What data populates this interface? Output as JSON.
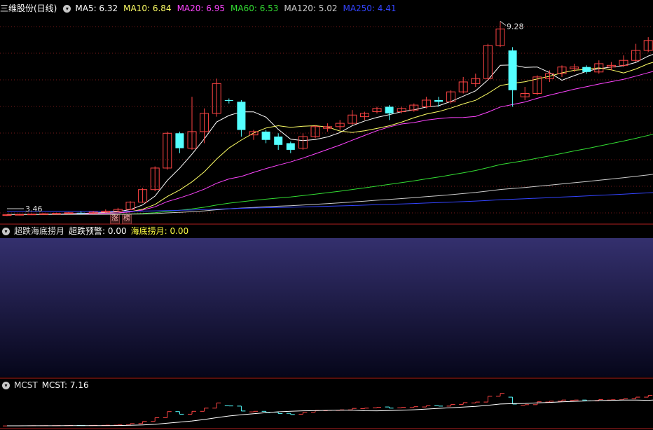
{
  "main_panel": {
    "title": "三维股份(日线)",
    "ma": [
      {
        "label": "MA5: 6.32",
        "color": "#ffffff"
      },
      {
        "label": "MA10: 6.84",
        "color": "#ffff66"
      },
      {
        "label": "MA20: 6.95",
        "color": "#ff44ff"
      },
      {
        "label": "MA60: 6.53",
        "color": "#33dd33"
      },
      {
        "label": "MA120: 5.02",
        "color": "#cccccc"
      },
      {
        "label": "MA250: 4.41",
        "color": "#3344ff"
      }
    ],
    "high_label": "9.28",
    "low_label": "3.46",
    "tags": [
      "涨",
      "榜"
    ]
  },
  "indicator_panel": {
    "name": "超跌海底捞月",
    "v1": "超跌预警: 0.00",
    "v2": "海底捞月: 0.00",
    "v2_color": "#ffff44"
  },
  "mcst_panel": {
    "name": "MCST",
    "value": "MCST: 7.16"
  },
  "chart_data": {
    "type": "candlestick",
    "price_range": [
      3.2,
      9.5
    ],
    "up_color": "#ff4444",
    "down_color": "#54ffff",
    "candles": [
      [
        3.42,
        3.46,
        3.4,
        3.44
      ],
      [
        3.44,
        3.47,
        3.42,
        3.45
      ],
      [
        3.45,
        3.48,
        3.43,
        3.46
      ],
      [
        3.46,
        3.49,
        3.44,
        3.47
      ],
      [
        3.47,
        3.5,
        3.45,
        3.48
      ],
      [
        3.48,
        3.52,
        3.46,
        3.5
      ],
      [
        3.5,
        3.54,
        3.48,
        3.49
      ],
      [
        3.49,
        3.55,
        3.47,
        3.52
      ],
      [
        3.52,
        3.6,
        3.5,
        3.55
      ],
      [
        3.55,
        3.65,
        3.52,
        3.6
      ],
      [
        3.6,
        3.85,
        3.58,
        3.82
      ],
      [
        3.82,
        4.25,
        3.8,
        4.2
      ],
      [
        4.2,
        4.9,
        4.15,
        4.85
      ],
      [
        4.85,
        5.95,
        4.8,
        5.9
      ],
      [
        5.9,
        5.95,
        5.3,
        5.45
      ],
      [
        5.45,
        7.0,
        5.4,
        5.95
      ],
      [
        5.95,
        6.65,
        5.6,
        6.5
      ],
      [
        6.5,
        7.55,
        6.4,
        7.4
      ],
      [
        6.9,
        6.95,
        6.8,
        6.88
      ],
      [
        6.85,
        6.9,
        5.8,
        6.0
      ],
      [
        5.85,
        6.0,
        5.7,
        5.95
      ],
      [
        5.95,
        6.0,
        5.6,
        5.7
      ],
      [
        5.8,
        5.9,
        5.4,
        5.55
      ],
      [
        5.6,
        5.65,
        5.3,
        5.4
      ],
      [
        5.45,
        5.9,
        5.4,
        5.8
      ],
      [
        5.8,
        6.15,
        5.75,
        6.1
      ],
      [
        6.05,
        6.2,
        5.95,
        6.1
      ],
      [
        6.1,
        6.3,
        6.0,
        6.2
      ],
      [
        6.2,
        6.6,
        6.15,
        6.45
      ],
      [
        6.4,
        6.55,
        6.3,
        6.5
      ],
      [
        6.55,
        6.7,
        6.5,
        6.65
      ],
      [
        6.7,
        6.75,
        6.3,
        6.5
      ],
      [
        6.55,
        6.7,
        6.5,
        6.65
      ],
      [
        6.6,
        6.8,
        6.55,
        6.75
      ],
      [
        6.7,
        7.0,
        6.65,
        6.9
      ],
      [
        6.9,
        7.0,
        6.7,
        6.85
      ],
      [
        6.85,
        7.2,
        6.8,
        7.15
      ],
      [
        7.15,
        7.6,
        7.1,
        7.45
      ],
      [
        7.4,
        7.7,
        7.3,
        7.55
      ],
      [
        7.55,
        8.6,
        7.5,
        8.55
      ],
      [
        8.55,
        9.28,
        8.5,
        9.05
      ],
      [
        8.4,
        8.5,
        6.7,
        7.2
      ],
      [
        7.0,
        7.3,
        6.9,
        7.1
      ],
      [
        7.1,
        7.65,
        7.05,
        7.6
      ],
      [
        7.55,
        7.8,
        7.45,
        7.7
      ],
      [
        7.7,
        7.95,
        7.6,
        7.9
      ],
      [
        7.85,
        8.0,
        7.75,
        7.9
      ],
      [
        7.9,
        7.95,
        7.7,
        7.75
      ],
      [
        7.75,
        8.1,
        7.7,
        8.0
      ],
      [
        7.9,
        8.05,
        7.8,
        7.95
      ],
      [
        7.95,
        8.25,
        7.9,
        8.1
      ],
      [
        8.1,
        8.6,
        8.05,
        8.4
      ],
      [
        8.4,
        8.8,
        8.35,
        8.7
      ],
      [
        8.7,
        8.85,
        8.55,
        8.65
      ],
      [
        8.65,
        8.9,
        8.6,
        8.85
      ],
      [
        8.85,
        8.95,
        8.4,
        8.5
      ],
      [
        8.15,
        8.4,
        7.55,
        7.7
      ],
      [
        7.6,
        7.65,
        7.05,
        7.2
      ],
      [
        7.1,
        7.3,
        6.95,
        7.25
      ],
      [
        7.25,
        7.35,
        6.95,
        7.15
      ],
      [
        6.8,
        6.85,
        6.2,
        6.3
      ],
      [
        6.2,
        6.25,
        5.9,
        5.95
      ],
      [
        6.0,
        6.4,
        5.85,
        6.3
      ],
      [
        6.35,
        6.6,
        6.25,
        6.55
      ],
      [
        6.55,
        6.7,
        6.4,
        6.6
      ],
      [
        6.65,
        6.9,
        6.55,
        6.85
      ],
      [
        6.9,
        7.4,
        6.85,
        7.05
      ],
      [
        7.2,
        7.7,
        7.1,
        7.6
      ],
      [
        7.55,
        8.55,
        7.5,
        7.95
      ],
      [
        7.9,
        8.0,
        7.25,
        7.4
      ],
      [
        7.3,
        7.4,
        7.0,
        7.35
      ],
      [
        7.35,
        7.55,
        7.2,
        7.5
      ]
    ],
    "ma_series": {
      "MA5": {
        "color": "#ffffff"
      },
      "MA10": {
        "color": "#ffff66"
      },
      "MA20": {
        "color": "#ff44ff"
      },
      "MA60": {
        "color": "#33dd33"
      },
      "MA120": {
        "color": "#cccccc"
      },
      "MA250": {
        "color": "#3344ff"
      }
    },
    "indicator_bars": [
      {
        "index": 58,
        "value": 0.45,
        "color": "#22dd22"
      },
      {
        "index": 59,
        "value": 1.0,
        "color": "#ff22ff"
      },
      {
        "index": 61,
        "value": 0.45,
        "color": "#22dd22"
      },
      {
        "index": 62,
        "value": 0.45,
        "color": "#22dd22"
      },
      {
        "index": 64,
        "value": 1.0,
        "color": "#ff22ff"
      }
    ]
  }
}
